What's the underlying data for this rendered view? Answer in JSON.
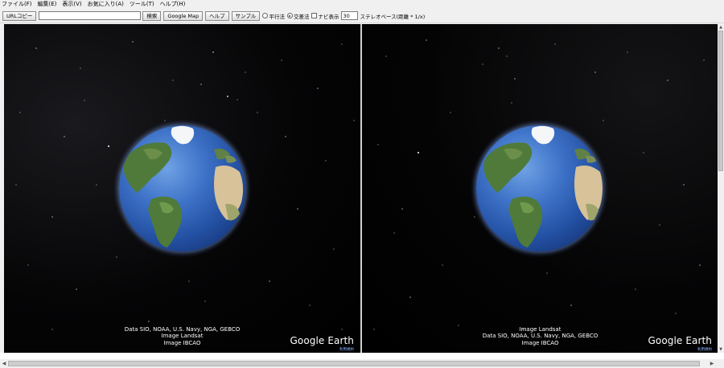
{
  "menubar": {
    "items": [
      {
        "id": "file",
        "label": "ファイル(F)"
      },
      {
        "id": "edit",
        "label": "編集(E)"
      },
      {
        "id": "view",
        "label": "表示(V)"
      },
      {
        "id": "favorites",
        "label": "お気に入り(A)"
      },
      {
        "id": "tools",
        "label": "ツール(T)"
      },
      {
        "id": "help",
        "label": "ヘルプ(H)"
      }
    ]
  },
  "toolbar": {
    "url_copy_label": "URLコピー",
    "search_value": "",
    "search_label": "検索",
    "google_map_label": "Google Map",
    "help_label": "ヘルプ",
    "sample_label": "サンプル",
    "parallel_label": "平行法",
    "parallel_checked": false,
    "cross_label": "交差法",
    "cross_checked": true,
    "navi_label": "ナビ表示",
    "navi_checked": false,
    "base_value": "30",
    "stereo_base_label": "ステレオベース(距離 * 1/x)"
  },
  "left_view": {
    "attribution": [
      "Data SIO, NOAA, U.S. Navy, NGA, GEBCO",
      "Image Landsat",
      "Image IBCAO"
    ],
    "logo": "Google Earth",
    "terms": "利用規約"
  },
  "right_view": {
    "attribution": [
      "Image Landsat",
      "Data SIO, NOAA, U.S. Navy, NGA, GEBCO",
      "Image IBCAO"
    ],
    "logo": "Google Earth",
    "terms": "利用規約"
  },
  "colors": {
    "space": "#000000",
    "ocean": "#2553a6",
    "land_green": "#4f7a3a",
    "desert": "#d7c29a",
    "ice": "#f4f6f8",
    "terms_link": "#8cb4ff"
  },
  "icons": {
    "scroll_up": "▲",
    "scroll_down": "▼",
    "scroll_left": "◀",
    "scroll_right": "▶"
  }
}
